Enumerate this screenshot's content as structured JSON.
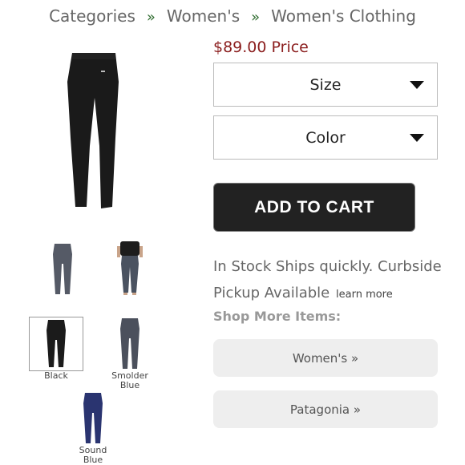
{
  "breadcrumb": {
    "items": [
      "Categories",
      "Women's",
      "Women's Clothing"
    ],
    "separator": "»"
  },
  "product": {
    "price": "$89.00 Price",
    "size_label": "Size",
    "color_label": "Color",
    "add_to_cart": "ADD TO CART",
    "stock_text": "In Stock Ships quickly. Curbside Pickup Available",
    "learn_more": "learn more"
  },
  "thumbnails": [
    {
      "label": "",
      "color": "#555a66"
    },
    {
      "label": "",
      "color": "#4a5260"
    },
    {
      "label": "Black",
      "color": "#1b1b1b",
      "selected": true
    },
    {
      "label": "Smolder Blue",
      "color": "#4b505c"
    },
    {
      "label": "Sound Blue",
      "color": "#2a3470"
    }
  ],
  "shop_more": {
    "heading": "Shop More Items:",
    "links": [
      "Women's »",
      "Patagonia »"
    ]
  },
  "colors": {
    "price": "#8b1e1e",
    "cart_bg": "#222222",
    "separator": "#2e6b2e"
  }
}
